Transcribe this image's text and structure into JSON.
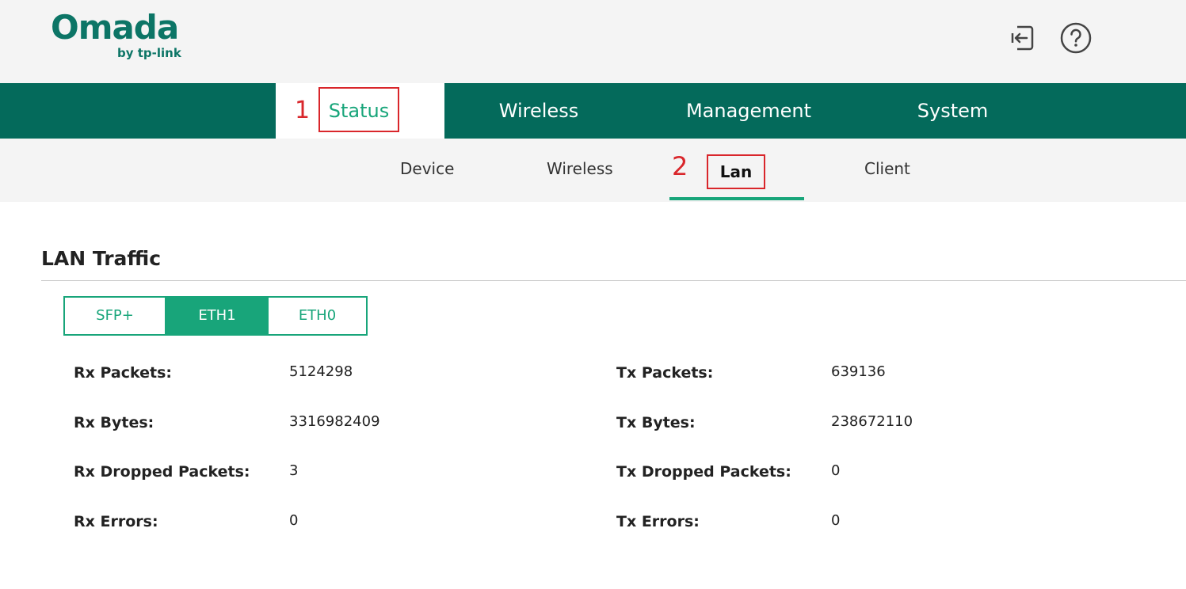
{
  "brand": {
    "name": "Omada",
    "sub": "by tp-link",
    "color": "#0c7566"
  },
  "header_icons": [
    {
      "name": "logout-icon"
    },
    {
      "name": "help-icon"
    }
  ],
  "main_nav": {
    "accent": "#046a5b",
    "tabs": [
      {
        "label": "Status",
        "active": true,
        "callout": "1"
      },
      {
        "label": "Wireless"
      },
      {
        "label": "Management"
      },
      {
        "label": "System"
      }
    ]
  },
  "sub_nav": {
    "tabs": [
      {
        "label": "Device"
      },
      {
        "label": "Wireless"
      },
      {
        "label": "Lan",
        "active": true,
        "callout": "2"
      },
      {
        "label": "Client"
      }
    ]
  },
  "section": {
    "title": "LAN Traffic"
  },
  "port_tabs": {
    "items": [
      "SFP+",
      "ETH1",
      "ETH0"
    ],
    "selected": "ETH1",
    "color": "#18a57a"
  },
  "stats": {
    "rx": [
      {
        "label": "Rx Packets:",
        "value": "5124298"
      },
      {
        "label": "Rx Bytes:",
        "value": "3316982409"
      },
      {
        "label": "Rx Dropped Packets:",
        "value": "3"
      },
      {
        "label": "Rx Errors:",
        "value": "0"
      }
    ],
    "tx": [
      {
        "label": "Tx Packets:",
        "value": "639136"
      },
      {
        "label": "Tx Bytes:",
        "value": "238672110"
      },
      {
        "label": "Tx Dropped Packets:",
        "value": "0"
      },
      {
        "label": "Tx Errors:",
        "value": "0"
      }
    ]
  }
}
